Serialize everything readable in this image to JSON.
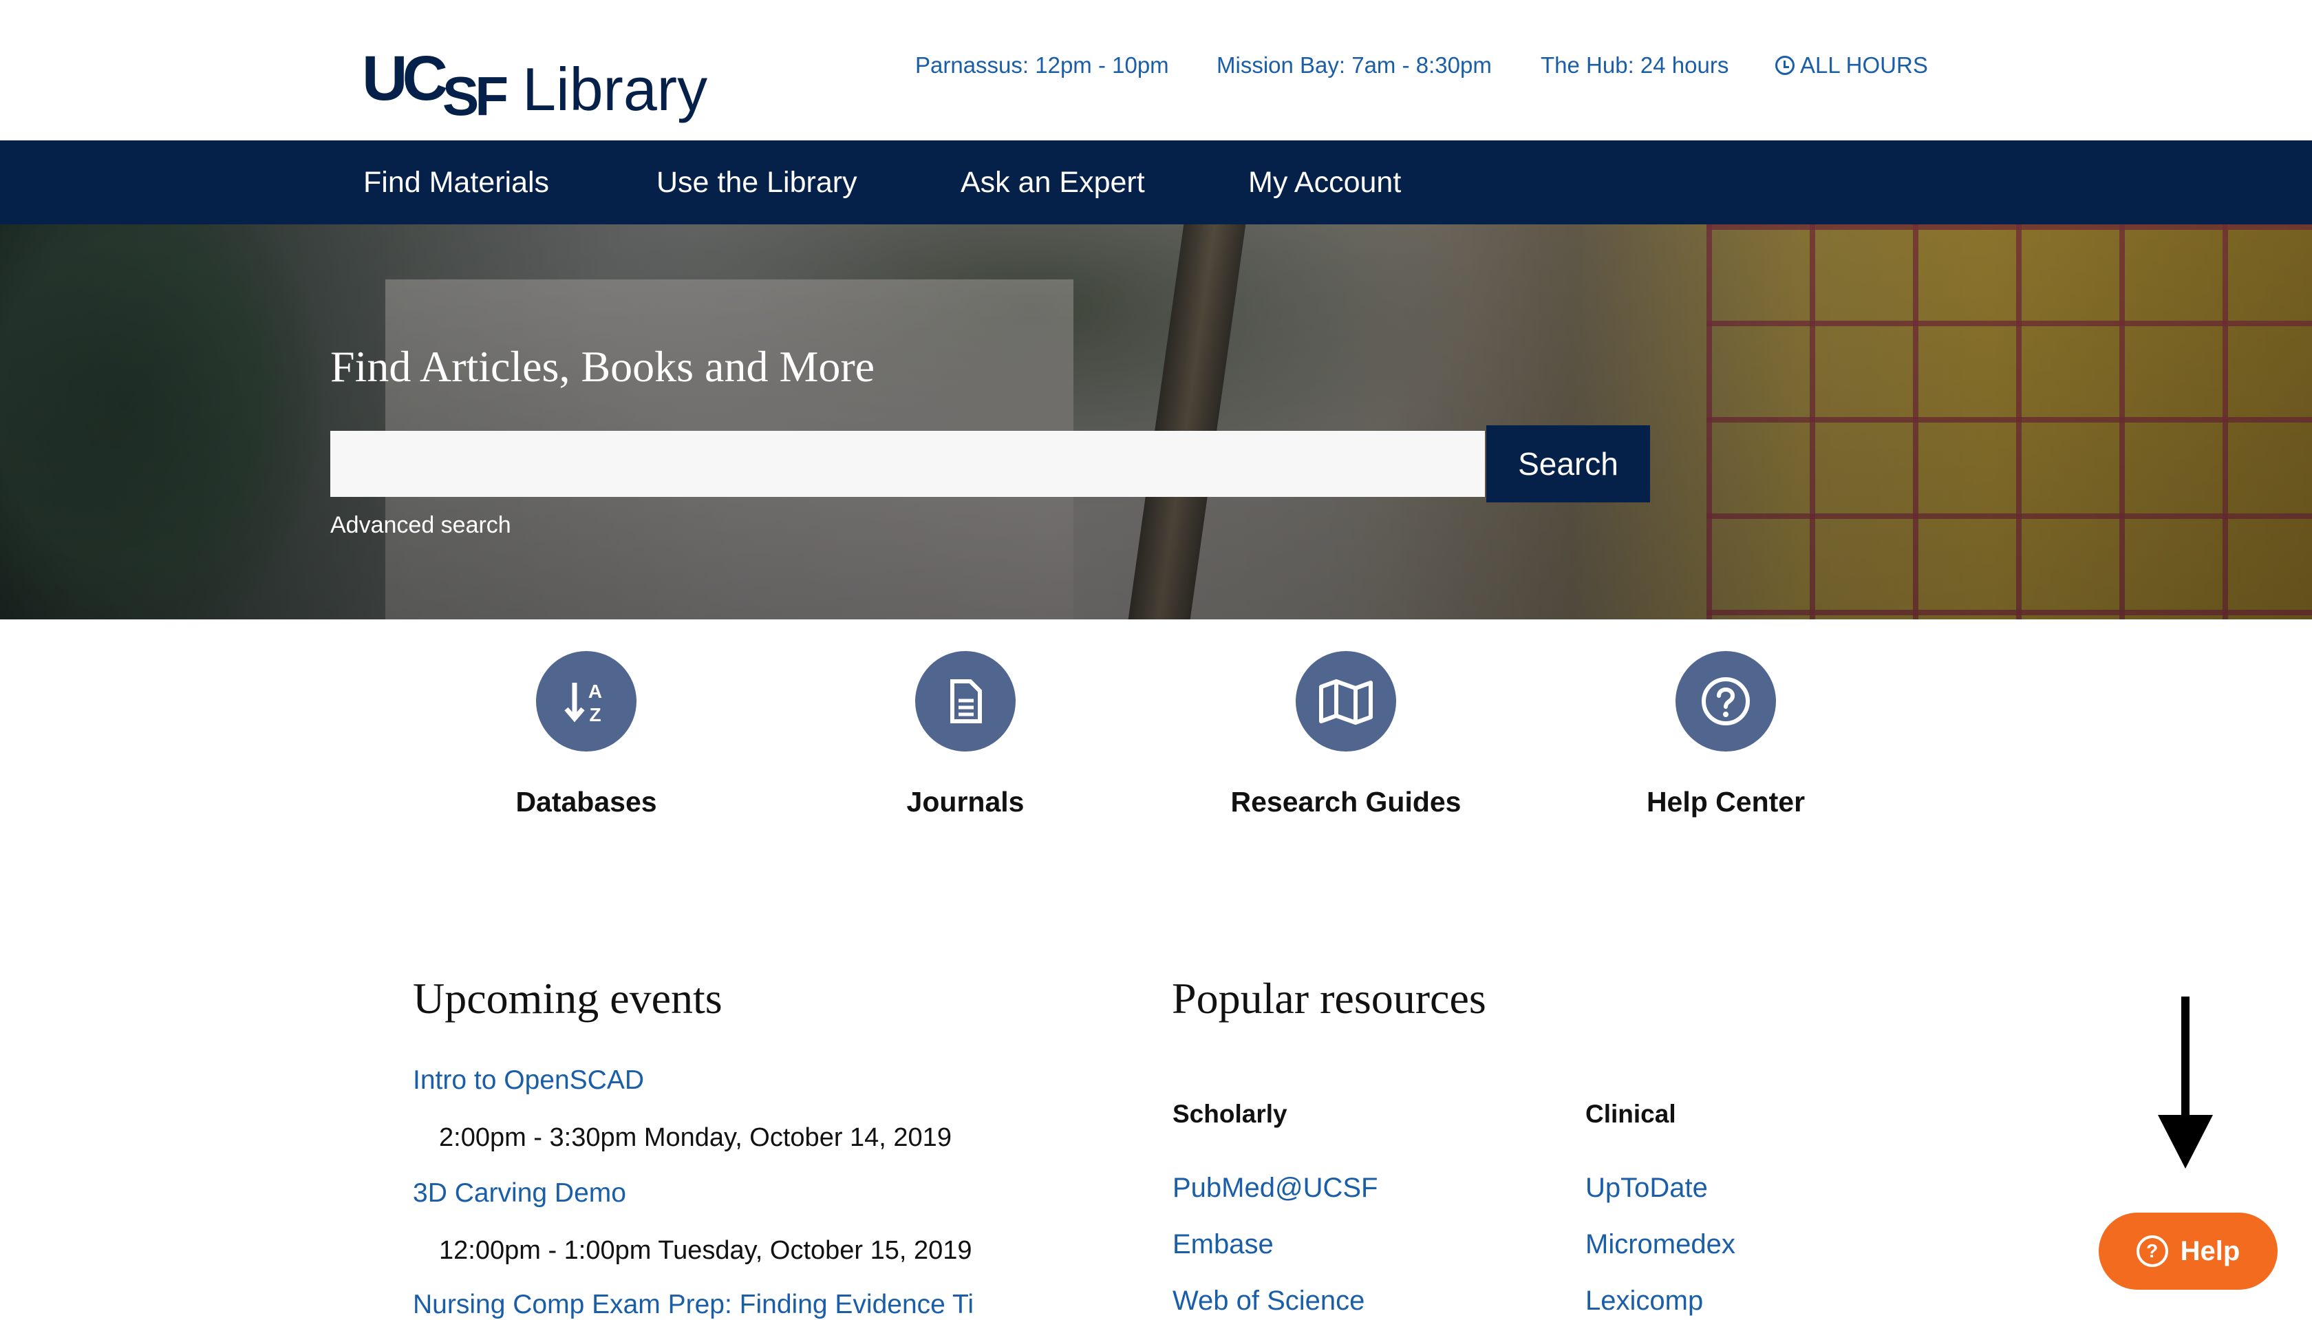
{
  "header": {
    "logo_mark": "UCSF",
    "logo_mark_uc": "UC",
    "logo_mark_sf": "SF",
    "logo_text": "Library",
    "hours": [
      {
        "label": "Parnassus: 12pm - 10pm"
      },
      {
        "label": "Mission Bay: 7am - 8:30pm"
      },
      {
        "label": "The Hub: 24 hours"
      }
    ],
    "all_hours": "ALL HOURS"
  },
  "nav": {
    "items": [
      {
        "label": "Find Materials"
      },
      {
        "label": "Use the Library"
      },
      {
        "label": "Ask an Expert"
      },
      {
        "label": "My Account"
      }
    ]
  },
  "hero": {
    "title": "Find Articles, Books and More",
    "search_value": "",
    "search_button": "Search",
    "advanced_link": "Advanced search"
  },
  "quick_links": [
    {
      "label": "Databases",
      "icon": "sort-az-icon"
    },
    {
      "label": "Journals",
      "icon": "document-icon"
    },
    {
      "label": "Research Guides",
      "icon": "map-icon"
    },
    {
      "label": "Help Center",
      "icon": "question-icon"
    }
  ],
  "events": {
    "title": "Upcoming events",
    "items": [
      {
        "title": "Intro to OpenSCAD",
        "time": "2:00pm - 3:30pm Monday, October 14, 2019"
      },
      {
        "title": "3D Carving Demo",
        "time": "12:00pm - 1:00pm Tuesday, October 15, 2019"
      },
      {
        "title": "Nursing Comp Exam Prep: Finding Evidence Ti"
      }
    ]
  },
  "resources": {
    "title": "Popular resources",
    "scholarly": {
      "heading": "Scholarly",
      "links": [
        "PubMed@UCSF",
        "Embase",
        "Web of Science"
      ]
    },
    "clinical": {
      "heading": "Clinical",
      "links": [
        "UpToDate",
        "Micromedex",
        "Lexicomp"
      ]
    }
  },
  "help_widget": {
    "label": "Help"
  },
  "colors": {
    "navy": "#052049",
    "link_blue": "#1a5ea8",
    "icon_circle": "#50668f",
    "help_orange": "#f26b1f"
  }
}
